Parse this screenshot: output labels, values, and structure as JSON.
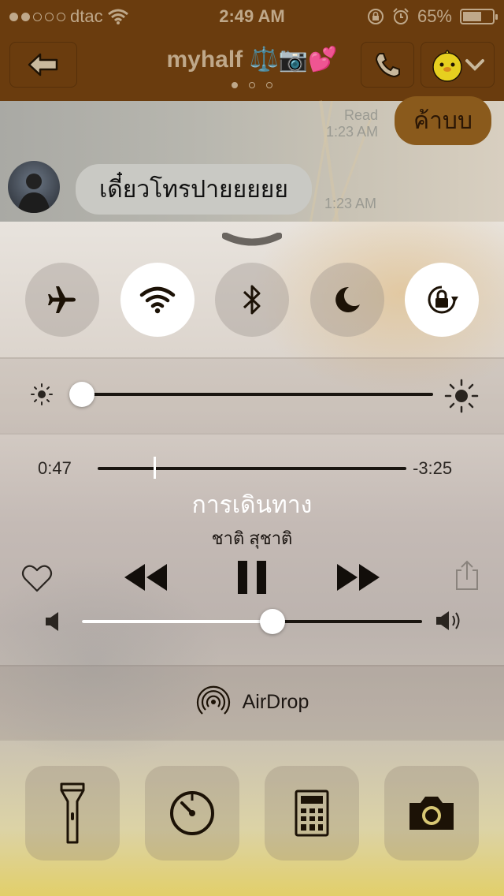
{
  "status_bar": {
    "carrier": "dtac",
    "time": "2:49 AM",
    "battery": "65%",
    "battery_level": 0.65,
    "signal_bars": 2
  },
  "chat_header": {
    "title": "myhalf ⚖️📷💕",
    "page_count": 3,
    "active_page": 1
  },
  "messages": [
    {
      "from": "me",
      "text": "ค้าบบ",
      "read": "Read",
      "time": "1:23 AM"
    },
    {
      "from": "them",
      "text": "เดี๋ยวโทรปายยยยย",
      "time": "1:23 AM"
    }
  ],
  "control_center": {
    "toggles": [
      {
        "name": "airplane-mode",
        "on": false
      },
      {
        "name": "wifi",
        "on": true
      },
      {
        "name": "bluetooth",
        "on": false
      },
      {
        "name": "do-not-disturb",
        "on": false
      },
      {
        "name": "rotation-lock",
        "on": true
      }
    ],
    "brightness": 0.0,
    "now_playing": {
      "elapsed": "0:47",
      "remaining": "-3:25",
      "progress": 0.18,
      "title": "การเดินทาง",
      "artist": "ชาติ สุชาติ"
    },
    "volume": 0.56,
    "airdrop_label": "AirDrop",
    "shortcuts": [
      "flashlight",
      "timer",
      "calculator",
      "camera"
    ]
  },
  "colors": {
    "header_bg": "#6a3c0e",
    "toggle_on": "#ffffff",
    "toggle_off": "#9a9089",
    "glyph": "#1c1206"
  }
}
